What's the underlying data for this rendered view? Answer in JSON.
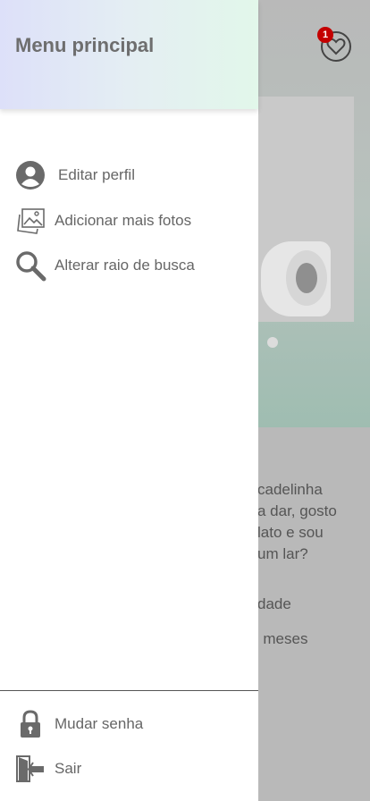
{
  "drawer": {
    "title": "Menu principal",
    "items": [
      {
        "label": "Editar perfil",
        "icon": "user-avatar-icon"
      },
      {
        "label": "Adicionar mais fotos",
        "icon": "photos-icon"
      },
      {
        "label": "Alterar raio de busca",
        "icon": "search-icon"
      }
    ],
    "footer_items": [
      {
        "label": "Mudar senha",
        "icon": "lock-icon"
      },
      {
        "label": "Sair",
        "icon": "exit-door-icon"
      }
    ]
  },
  "background": {
    "notification_count": "1",
    "description_lines": [
      "cadelinha",
      "a dar, gosto",
      "lato e sou",
      "um lar?"
    ],
    "detail_lines": [
      "dade",
      "- meses"
    ]
  },
  "colors": {
    "badge": "#c40000",
    "header_gradient_start": "#dde0f9",
    "header_gradient_end": "#e2f7ea",
    "overlay": "#b9b9b9"
  }
}
